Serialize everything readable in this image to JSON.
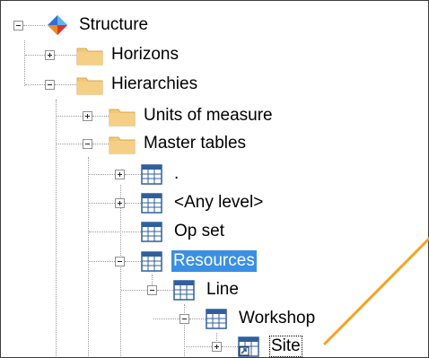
{
  "tree": {
    "root": {
      "label": "Structure",
      "expanded": true,
      "icon": "structure-diamond-icon"
    },
    "horizons": {
      "label": "Horizons",
      "expanded": false,
      "icon": "folder-icon"
    },
    "hierarchies": {
      "label": "Hierarchies",
      "expanded": true,
      "icon": "folder-icon"
    },
    "units_of_measure": {
      "label": "Units of measure",
      "expanded": false,
      "icon": "folder-icon"
    },
    "master_tables": {
      "label": "Master tables",
      "expanded": true,
      "icon": "folder-icon"
    },
    "dot": {
      "label": ".",
      "expanded": false,
      "icon": "table-icon"
    },
    "any_level": {
      "label": "<Any level>",
      "expanded": false,
      "icon": "table-icon"
    },
    "op_set": {
      "label": "Op set",
      "icon": "table-icon"
    },
    "resources": {
      "label": "Resources",
      "expanded": true,
      "selected": true,
      "icon": "table-icon"
    },
    "line": {
      "label": "Line",
      "expanded": true,
      "icon": "table-icon"
    },
    "workshop": {
      "label": "Workshop",
      "expanded": true,
      "icon": "table-icon"
    },
    "site": {
      "label": "Site",
      "expanded": false,
      "focused": true,
      "icon": "table-link-icon"
    }
  },
  "colors": {
    "selection": "#3a8fe2",
    "folder": "#f1c77a",
    "table_icon": "#2f5f9e",
    "annotation_line": "#f4a321"
  }
}
